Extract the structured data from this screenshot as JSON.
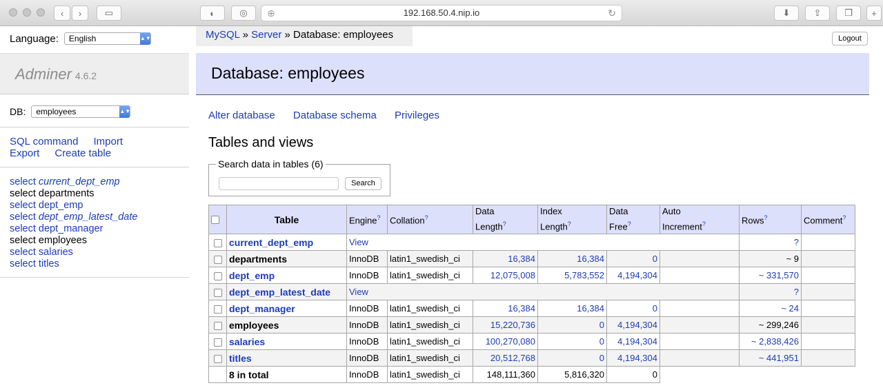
{
  "browser": {
    "url": "192.168.50.4.nip.io"
  },
  "sidebar": {
    "language_label": "Language:",
    "language_value": "English",
    "brand": "Adminer",
    "version": "4.6.2",
    "db_label": "DB:",
    "db_value": "employees",
    "links": [
      "SQL command",
      "Import",
      "Export",
      "Create table"
    ],
    "tables": [
      {
        "label": "select",
        "name": "current_dept_emp",
        "italic": true
      },
      {
        "label": "select",
        "name": "departments",
        "italic": false
      },
      {
        "label": "select",
        "name": "dept_emp",
        "italic": false
      },
      {
        "label": "select",
        "name": "dept_emp_latest_date",
        "italic": true
      },
      {
        "label": "select",
        "name": "dept_manager",
        "italic": false
      },
      {
        "label": "select",
        "name": "employees",
        "italic": false
      },
      {
        "label": "select",
        "name": "salaries",
        "italic": false
      },
      {
        "label": "select",
        "name": "titles",
        "italic": false
      }
    ]
  },
  "breadcrumb": {
    "mysql": "MySQL",
    "sep1": "»",
    "server": "Server",
    "sep2": "»",
    "current": "Database: employees"
  },
  "logout_label": "Logout",
  "page_title": "Database: employees",
  "actions": [
    "Alter database",
    "Database schema",
    "Privileges"
  ],
  "section_title": "Tables and views",
  "search": {
    "legend": "Search data in tables (6)",
    "input_value": "",
    "button": "Search"
  },
  "table": {
    "headers": {
      "table": "Table",
      "engine": "Engine",
      "collation": "Collation",
      "data_length_1": "Data",
      "data_length_2": "Length",
      "index_length_1": "Index",
      "index_length_2": "Length",
      "data_free_1": "Data",
      "data_free_2": "Free",
      "auto_inc_1": "Auto",
      "auto_inc_2": "Increment",
      "rows": "Rows",
      "comment": "Comment",
      "help": "?"
    },
    "rows": [
      {
        "name": "current_dept_emp",
        "view": "View",
        "rows": "?"
      },
      {
        "name": "departments",
        "engine": "InnoDB",
        "collation": "latin1_swedish_ci",
        "data_length": "16,384",
        "index_length": "16,384",
        "data_free": "0",
        "auto_increment": "",
        "rows": "~ 9",
        "comment": ""
      },
      {
        "name": "dept_emp",
        "engine": "InnoDB",
        "collation": "latin1_swedish_ci",
        "data_length": "12,075,008",
        "index_length": "5,783,552",
        "data_free": "4,194,304",
        "auto_increment": "",
        "rows": "~ 331,570",
        "comment": ""
      },
      {
        "name": "dept_emp_latest_date",
        "view": "View",
        "rows": "?"
      },
      {
        "name": "dept_manager",
        "engine": "InnoDB",
        "collation": "latin1_swedish_ci",
        "data_length": "16,384",
        "index_length": "16,384",
        "data_free": "0",
        "auto_increment": "",
        "rows": "~ 24",
        "comment": ""
      },
      {
        "name": "employees",
        "engine": "InnoDB",
        "collation": "latin1_swedish_ci",
        "data_length": "15,220,736",
        "index_length": "0",
        "data_free": "4,194,304",
        "auto_increment": "",
        "rows": "~ 299,246",
        "comment": ""
      },
      {
        "name": "salaries",
        "engine": "InnoDB",
        "collation": "latin1_swedish_ci",
        "data_length": "100,270,080",
        "index_length": "0",
        "data_free": "4,194,304",
        "auto_increment": "",
        "rows": "~ 2,838,426",
        "comment": ""
      },
      {
        "name": "titles",
        "engine": "InnoDB",
        "collation": "latin1_swedish_ci",
        "data_length": "20,512,768",
        "index_length": "0",
        "data_free": "4,194,304",
        "auto_increment": "",
        "rows": "~ 441,951",
        "comment": ""
      }
    ],
    "total": {
      "label": "8 in total",
      "engine": "InnoDB",
      "collation": "latin1_swedish_ci",
      "data_length": "148,111,360",
      "index_length": "5,816,320",
      "data_free": "0"
    }
  }
}
